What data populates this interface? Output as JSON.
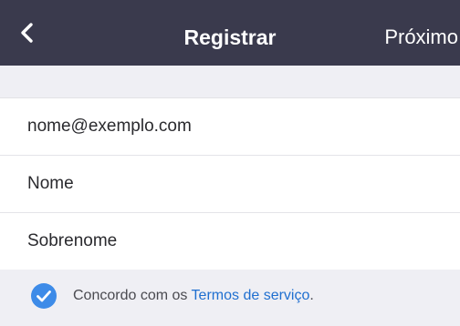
{
  "header": {
    "title": "Registrar",
    "next_label": "Próximo",
    "back_icon": "chevron-left-icon"
  },
  "form": {
    "email_value": "nome@exemplo.com",
    "first_name_placeholder": "Nome",
    "last_name_placeholder": "Sobrenome"
  },
  "agreement": {
    "prefix": "Concordo com os ",
    "link_label": "Termos de serviço",
    "suffix": ".",
    "checked": true,
    "check_icon": "check-circle-icon"
  },
  "colors": {
    "header_bg": "#3a3a4d",
    "accent": "#1f6fd0",
    "check_fill": "#3d8be8"
  }
}
